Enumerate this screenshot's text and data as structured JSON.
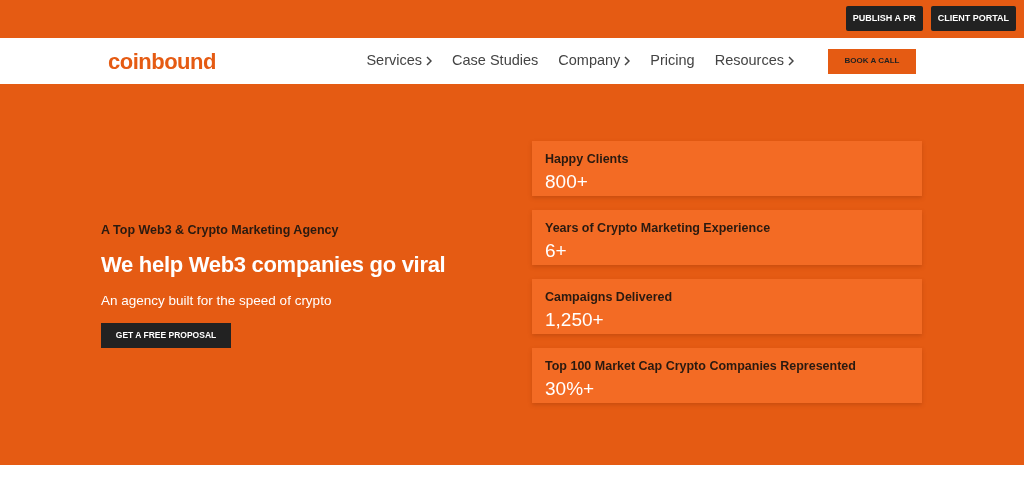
{
  "top_bar": {
    "buttons": [
      "PUBLISH A PR",
      "CLIENT PORTAL"
    ]
  },
  "navbar": {
    "logo": "coinbound",
    "items": [
      {
        "label": "Services",
        "has_menu": true
      },
      {
        "label": "Case Studies",
        "has_menu": false
      },
      {
        "label": "Company",
        "has_menu": true
      },
      {
        "label": "Pricing",
        "has_menu": false
      },
      {
        "label": "Resources",
        "has_menu": true
      }
    ],
    "cta": "BOOK A CALL"
  },
  "hero": {
    "eyebrow": "A Top Web3 & Crypto Marketing Agency",
    "heading": "We help Web3 companies go viral",
    "subheading": "An agency built for the speed of crypto",
    "button": "GET A FREE PROPOSAL"
  },
  "stats": [
    {
      "label": "Happy Clients",
      "value": "800+"
    },
    {
      "label": "Years of Crypto Marketing Experience",
      "value": "6+"
    },
    {
      "label": "Campaigns Delivered",
      "value": "1,250+"
    },
    {
      "label": "Top 100 Market Cap Crypto Companies Represented",
      "value": "30%+"
    }
  ]
}
